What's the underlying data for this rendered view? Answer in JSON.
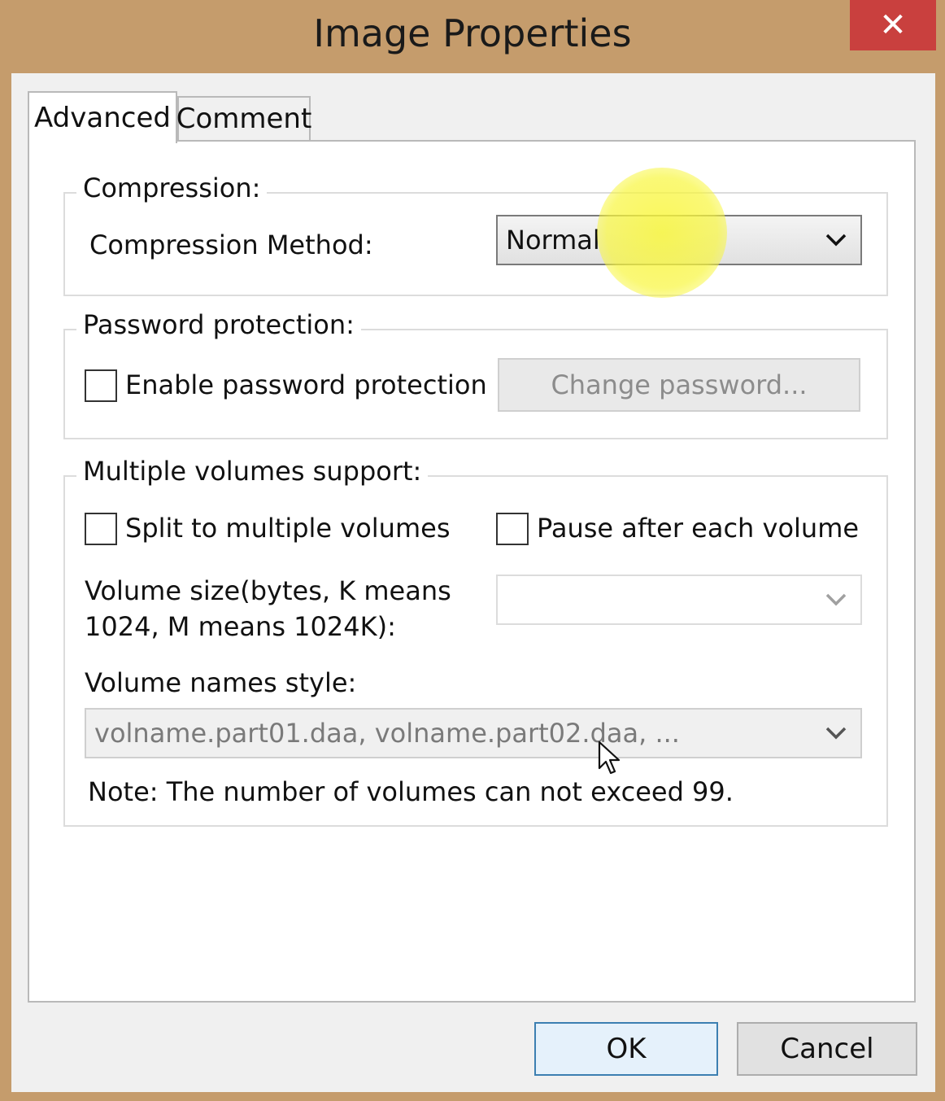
{
  "window": {
    "title": "Image Properties",
    "close_glyph": "✕"
  },
  "tabs": [
    {
      "label": "Advanced",
      "selected": true
    },
    {
      "label": "Comment",
      "selected": false
    }
  ],
  "compression": {
    "legend": "Compression:",
    "method_label": "Compression Method:",
    "method_value": "Normal"
  },
  "password": {
    "legend": "Password protection:",
    "enable_label": "Enable password protection",
    "enable_checked": false,
    "change_button": "Change password..."
  },
  "volumes": {
    "legend": "Multiple volumes support:",
    "split_label": "Split to multiple volumes",
    "split_checked": false,
    "pause_label": "Pause after each volume",
    "pause_checked": false,
    "size_label_line1": "Volume size(bytes, K means",
    "size_label_line2": "1024, M means 1024K):",
    "size_value": "",
    "names_style_label": "Volume names style:",
    "names_style_value": "volname.part01.daa, volname.part02.daa, ...",
    "note_prefix": "Note:",
    "note_text": " The number of volumes can not exceed 99."
  },
  "buttons": {
    "ok": "OK",
    "cancel": "Cancel"
  },
  "colors": {
    "title_bar": "#c59c6c",
    "close": "#c9403e",
    "highlight": "#f8f63c",
    "default_button_border": "#3c7fb1"
  }
}
